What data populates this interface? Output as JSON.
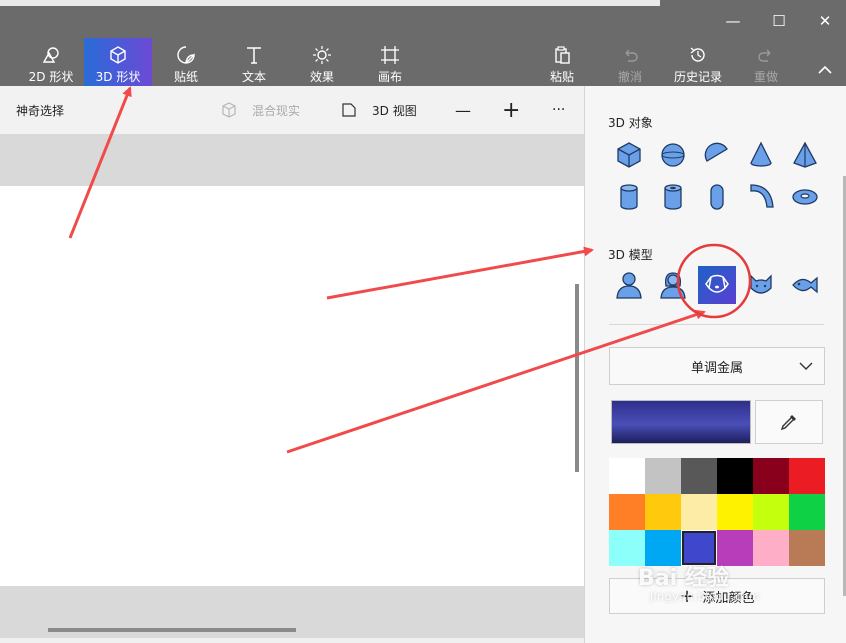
{
  "window": {
    "minimize": "—",
    "maximize": "☐",
    "close": "✕"
  },
  "ribbon": {
    "tools": [
      {
        "label": "2D 形状",
        "icon": "2d-shapes-icon"
      },
      {
        "label": "3D 形状",
        "icon": "3d-cube-icon",
        "active": true
      },
      {
        "label": "贴纸",
        "icon": "sticker-icon"
      },
      {
        "label": "文本",
        "icon": "text-icon"
      },
      {
        "label": "效果",
        "icon": "effects-sun-icon"
      },
      {
        "label": "画布",
        "icon": "canvas-crop-icon"
      }
    ],
    "right_tools": [
      {
        "label": "粘贴",
        "icon": "paste-icon"
      },
      {
        "label": "撤消",
        "icon": "undo-icon",
        "disabled": true
      },
      {
        "label": "历史记录",
        "icon": "history-icon"
      },
      {
        "label": "重做",
        "icon": "redo-icon",
        "disabled": true
      }
    ],
    "collapse": "^"
  },
  "subbar": {
    "magic_select": "神奇选择",
    "mixed_reality": "混合现实",
    "view3d": "3D 视图",
    "zoom_out": "—",
    "zoom_in": "+",
    "more": "···"
  },
  "panel": {
    "objects_title": "3D 对象",
    "models_title": "3D 模型",
    "objects": [
      "cube-icon",
      "sphere-icon",
      "hemisphere-icon",
      "cone-icon",
      "pyramid-icon",
      "cylinder-icon",
      "tube-icon",
      "capsule-icon",
      "elbow-pipe-icon",
      "donut-icon"
    ],
    "models": [
      "man-icon",
      "woman-icon",
      "dog-icon",
      "cat-icon",
      "fish-icon"
    ],
    "selected_model": "dog-icon",
    "material": "单调金属",
    "current_color": "#2e2f8c",
    "palette": [
      "#ffffff",
      "#c3c3c3",
      "#585858",
      "#000000",
      "#88001b",
      "#ec1c24",
      "#ff7f27",
      "#ffc90e",
      "#fdeca6",
      "#fff200",
      "#c4ff0e",
      "#0ed145",
      "#8cfffb",
      "#00a8f3",
      "#3f48cc",
      "#b83dba",
      "#ffaec8",
      "#b97a56"
    ],
    "selected_color_index": 14,
    "add_color": "添加颜色"
  },
  "watermark": {
    "brand": "Bai 经验",
    "url": "jingyan.baidu.com"
  },
  "accent": {
    "arrow": "#f04a4a",
    "active_tab": "#3b5fd9"
  }
}
